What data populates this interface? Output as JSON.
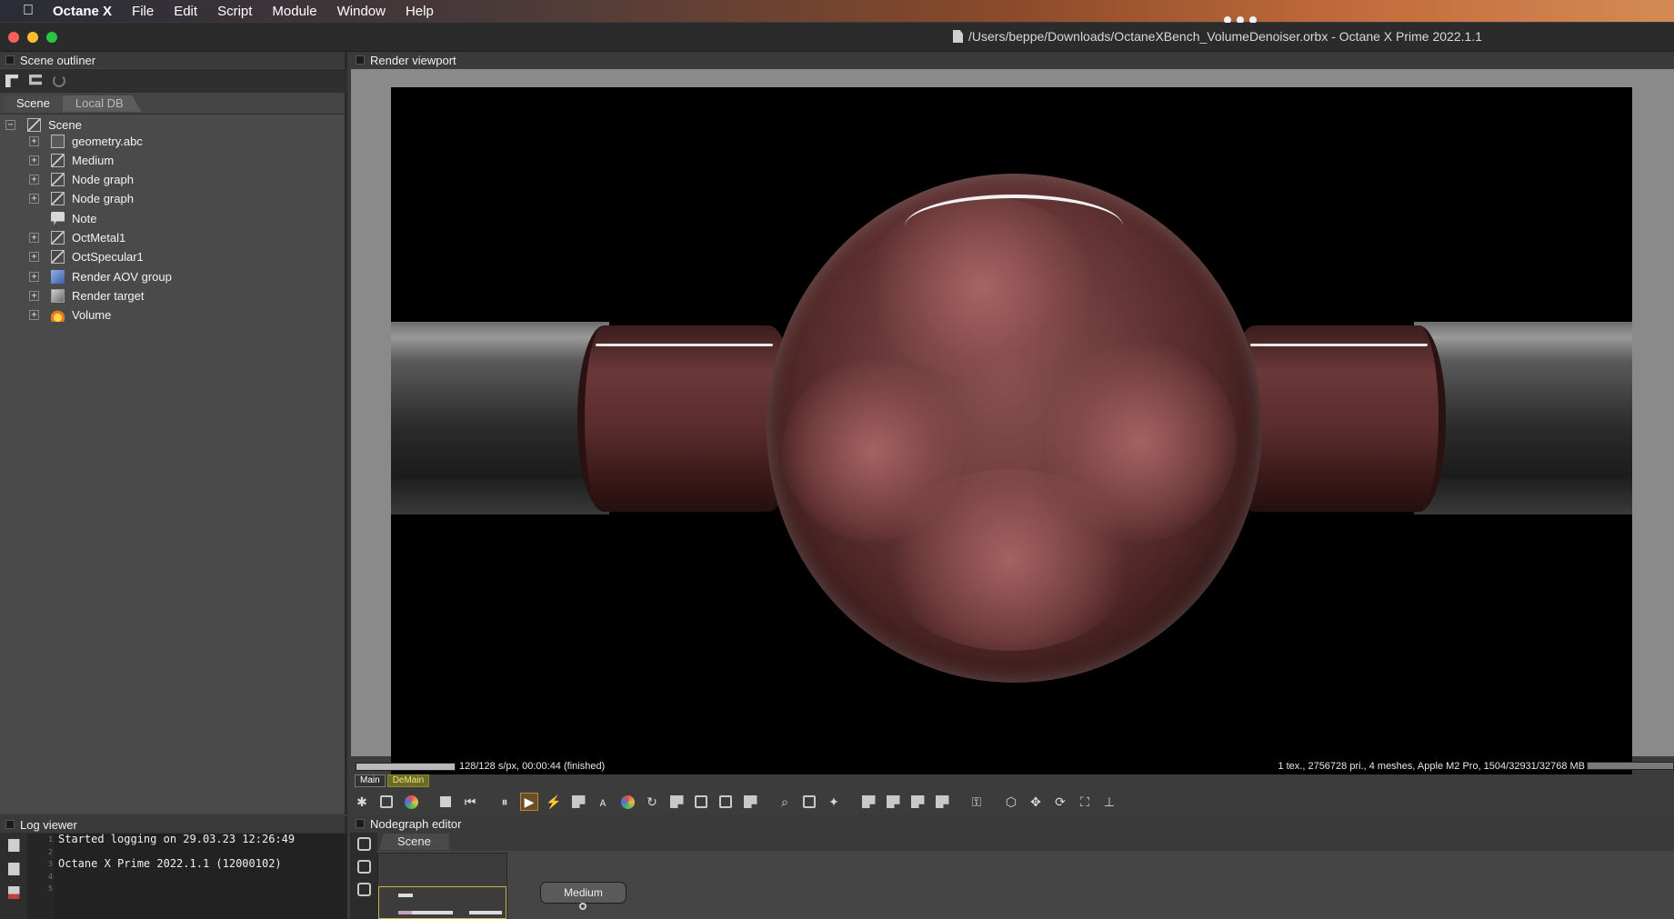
{
  "menubar": {
    "app_name": "Octane X",
    "items": [
      "File",
      "Edit",
      "Script",
      "Module",
      "Window",
      "Help"
    ]
  },
  "window": {
    "title": "/Users/beppe/Downloads/OctaneXBench_VolumeDenoiser.orbx - Octane X Prime 2022.1.1"
  },
  "outliner": {
    "header": "Scene outliner",
    "tabs": [
      "Scene",
      "Local DB"
    ],
    "root": "Scene",
    "items": [
      {
        "label": "geometry.abc",
        "icon": "geometry-icon",
        "expandable": true
      },
      {
        "label": "Medium",
        "icon": "node-graph-icon",
        "expandable": true
      },
      {
        "label": "Node graph",
        "icon": "node-graph-icon",
        "expandable": true
      },
      {
        "label": "Node graph",
        "icon": "node-graph-icon",
        "expandable": true
      },
      {
        "label": "Note",
        "icon": "note-icon",
        "expandable": false
      },
      {
        "label": "OctMetal1",
        "icon": "node-graph-icon",
        "expandable": true
      },
      {
        "label": "OctSpecular1",
        "icon": "node-graph-icon",
        "expandable": true
      },
      {
        "label": "Render AOV group",
        "icon": "aov-group-icon",
        "expandable": true
      },
      {
        "label": "Render target",
        "icon": "render-target-icon",
        "expandable": true
      },
      {
        "label": "Volume",
        "icon": "volume-flame-icon",
        "expandable": true
      }
    ]
  },
  "viewport": {
    "header": "Render viewport",
    "status_left": "128/128 s/px, 00:00:44 (finished)",
    "status_right": "1 tex., 2756728 pri., 4 meshes, Apple M2 Pro, 1504/32931/32768 MB",
    "progress": 1.0,
    "modes": [
      "Main",
      "DeMain"
    ],
    "active_mode": "DeMain"
  },
  "log": {
    "header": "Log viewer",
    "line_numbers": [
      "1",
      "2",
      "3",
      "4",
      "5"
    ],
    "lines": [
      "Started logging on 29.03.23 12:26:49",
      "",
      "Octane X Prime 2022.1.1 (12000102)",
      "",
      ""
    ]
  },
  "nodegraph": {
    "header": "Nodegraph editor",
    "tab": "Scene",
    "node_label": "Medium"
  },
  "colors": {
    "accent_play": "#b8862c",
    "demain_text": "#f1e77a",
    "window_bg": "#3b3b3b"
  }
}
